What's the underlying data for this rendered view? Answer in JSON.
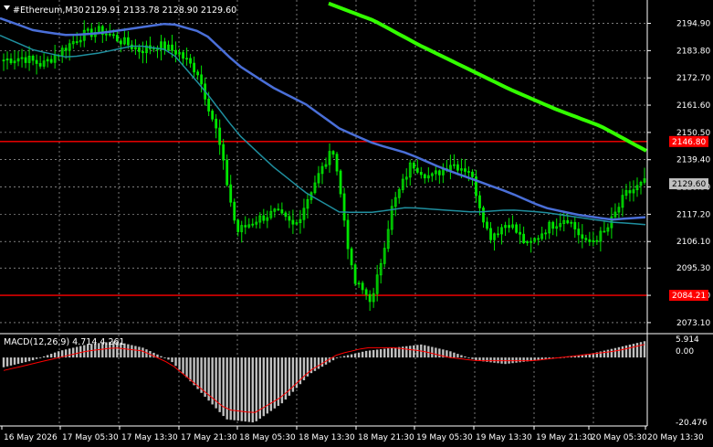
{
  "header": {
    "menu_icon": "triangle-down-icon",
    "symbol": "#Ethereum,M30",
    "ohlc": "2129.91 2133.78 2128.90 2129.60"
  },
  "macd": {
    "label": "MACD(12,26,9) 4.714 4.261",
    "scale_top": "5.914",
    "scale_mid": "0.00",
    "scale_bottom": "-20.476"
  },
  "price_axis": {
    "ticks": [
      "2194.90",
      "2183.80",
      "2172.70",
      "2161.60",
      "2150.50",
      "2139.40",
      "2128.30",
      "2117.20",
      "2106.10",
      "2095.30",
      "2084.20",
      "2073.10"
    ],
    "current_price": "2129.60",
    "levels": [
      {
        "label": "2146.80",
        "value": 2146.8,
        "color": "#ff0000"
      },
      {
        "label": "2084.21",
        "value": 2084.21,
        "color": "#ff0000"
      }
    ]
  },
  "time_axis": {
    "labels": [
      "16 May 2026",
      "17 May 05:30",
      "17 May 13:30",
      "17 May 21:30",
      "18 May 05:30",
      "18 May 13:30",
      "18 May 21:30",
      "19 May 05:30",
      "19 May 13:30",
      "19 May 21:30",
      "20 May 05:30",
      "20 May 13:30"
    ]
  },
  "colors": {
    "background": "#000000",
    "grid": "#c8c8c8",
    "candle": "#00e600",
    "ma_fast": "#4a6fd8",
    "ma_mid": "#1f8f9f",
    "ma_slow": "#33ff00",
    "macd_hist": "#c0c0c0",
    "macd_signal": "#ff0000",
    "level": "#ff0000",
    "current_price_bg": "#c0c0c0"
  },
  "chart_data": {
    "type": "line",
    "title": "#Ethereum,M30",
    "y_range": [
      2070,
      2200
    ],
    "price_checkpoints": [
      2180,
      2181,
      2178,
      2184,
      2190,
      2192,
      2188,
      2184,
      2186,
      2183,
      2175,
      2150,
      2110,
      2115,
      2118,
      2112,
      2130,
      2144,
      2090,
      2082,
      2120,
      2138,
      2132,
      2138,
      2135,
      2108,
      2114,
      2104,
      2112,
      2116,
      2105,
      2110,
      2125,
      2130
    ],
    "ma_fast_checkpoints": [
      2197,
      2192,
      2190,
      2191,
      2193,
      2195,
      2191,
      2178,
      2169,
      2162,
      2152,
      2146,
      2142,
      2136,
      2131,
      2126,
      2120,
      2117,
      2115,
      2116
    ],
    "ma_mid_checkpoints": [
      2190,
      2184,
      2181,
      2183,
      2186,
      2184,
      2168,
      2150,
      2137,
      2126,
      2118,
      2118,
      2120,
      2119,
      2118,
      2119,
      2118,
      2116,
      2114,
      2113
    ],
    "ma_slow_checkpoints": [
      2203,
      2196,
      2186,
      2177,
      2168,
      2160,
      2153,
      2143
    ],
    "macd_hist_checkpoints": [
      -3,
      -1,
      2,
      4,
      5,
      3,
      -1,
      -10,
      -19,
      -20,
      -14,
      -5,
      0,
      2,
      3,
      4,
      2,
      -1,
      -2,
      -1,
      0,
      1,
      3,
      5
    ],
    "macd_signal_checkpoints": [
      -4,
      -2,
      0,
      2,
      3,
      2,
      -2,
      -9,
      -16,
      -17,
      -12,
      -4,
      1,
      3,
      3,
      2,
      0,
      -1,
      -1,
      -1,
      0,
      1,
      2,
      4
    ]
  }
}
